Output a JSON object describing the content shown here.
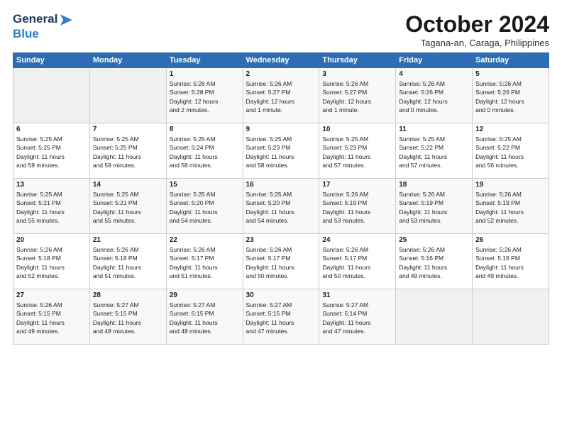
{
  "logo": {
    "line1": "General",
    "line2": "Blue"
  },
  "title": "October 2024",
  "location": "Tagana-an, Caraga, Philippines",
  "header_days": [
    "Sunday",
    "Monday",
    "Tuesday",
    "Wednesday",
    "Thursday",
    "Friday",
    "Saturday"
  ],
  "weeks": [
    [
      {
        "day": "",
        "info": ""
      },
      {
        "day": "",
        "info": ""
      },
      {
        "day": "1",
        "info": "Sunrise: 5:26 AM\nSunset: 5:28 PM\nDaylight: 12 hours\nand 2 minutes."
      },
      {
        "day": "2",
        "info": "Sunrise: 5:26 AM\nSunset: 5:27 PM\nDaylight: 12 hours\nand 1 minute."
      },
      {
        "day": "3",
        "info": "Sunrise: 5:26 AM\nSunset: 5:27 PM\nDaylight: 12 hours\nand 1 minute."
      },
      {
        "day": "4",
        "info": "Sunrise: 5:26 AM\nSunset: 5:26 PM\nDaylight: 12 hours\nand 0 minutes."
      },
      {
        "day": "5",
        "info": "Sunrise: 5:26 AM\nSunset: 5:26 PM\nDaylight: 12 hours\nand 0 minutes."
      }
    ],
    [
      {
        "day": "6",
        "info": "Sunrise: 5:25 AM\nSunset: 5:25 PM\nDaylight: 11 hours\nand 59 minutes."
      },
      {
        "day": "7",
        "info": "Sunrise: 5:25 AM\nSunset: 5:25 PM\nDaylight: 11 hours\nand 59 minutes."
      },
      {
        "day": "8",
        "info": "Sunrise: 5:25 AM\nSunset: 5:24 PM\nDaylight: 11 hours\nand 58 minutes."
      },
      {
        "day": "9",
        "info": "Sunrise: 5:25 AM\nSunset: 5:23 PM\nDaylight: 11 hours\nand 58 minutes."
      },
      {
        "day": "10",
        "info": "Sunrise: 5:25 AM\nSunset: 5:23 PM\nDaylight: 11 hours\nand 57 minutes."
      },
      {
        "day": "11",
        "info": "Sunrise: 5:25 AM\nSunset: 5:22 PM\nDaylight: 11 hours\nand 57 minutes."
      },
      {
        "day": "12",
        "info": "Sunrise: 5:25 AM\nSunset: 5:22 PM\nDaylight: 11 hours\nand 56 minutes."
      }
    ],
    [
      {
        "day": "13",
        "info": "Sunrise: 5:25 AM\nSunset: 5:21 PM\nDaylight: 11 hours\nand 55 minutes."
      },
      {
        "day": "14",
        "info": "Sunrise: 5:25 AM\nSunset: 5:21 PM\nDaylight: 11 hours\nand 55 minutes."
      },
      {
        "day": "15",
        "info": "Sunrise: 5:25 AM\nSunset: 5:20 PM\nDaylight: 11 hours\nand 54 minutes."
      },
      {
        "day": "16",
        "info": "Sunrise: 5:25 AM\nSunset: 5:20 PM\nDaylight: 11 hours\nand 54 minutes."
      },
      {
        "day": "17",
        "info": "Sunrise: 5:26 AM\nSunset: 5:19 PM\nDaylight: 11 hours\nand 53 minutes."
      },
      {
        "day": "18",
        "info": "Sunrise: 5:26 AM\nSunset: 5:19 PM\nDaylight: 11 hours\nand 53 minutes."
      },
      {
        "day": "19",
        "info": "Sunrise: 5:26 AM\nSunset: 5:19 PM\nDaylight: 11 hours\nand 52 minutes."
      }
    ],
    [
      {
        "day": "20",
        "info": "Sunrise: 5:26 AM\nSunset: 5:18 PM\nDaylight: 11 hours\nand 52 minutes."
      },
      {
        "day": "21",
        "info": "Sunrise: 5:26 AM\nSunset: 5:18 PM\nDaylight: 11 hours\nand 51 minutes."
      },
      {
        "day": "22",
        "info": "Sunrise: 5:26 AM\nSunset: 5:17 PM\nDaylight: 11 hours\nand 51 minutes."
      },
      {
        "day": "23",
        "info": "Sunrise: 5:26 AM\nSunset: 5:17 PM\nDaylight: 11 hours\nand 50 minutes."
      },
      {
        "day": "24",
        "info": "Sunrise: 5:26 AM\nSunset: 5:17 PM\nDaylight: 11 hours\nand 50 minutes."
      },
      {
        "day": "25",
        "info": "Sunrise: 5:26 AM\nSunset: 5:16 PM\nDaylight: 11 hours\nand 49 minutes."
      },
      {
        "day": "26",
        "info": "Sunrise: 5:26 AM\nSunset: 5:16 PM\nDaylight: 11 hours\nand 49 minutes."
      }
    ],
    [
      {
        "day": "27",
        "info": "Sunrise: 5:26 AM\nSunset: 5:15 PM\nDaylight: 11 hours\nand 49 minutes."
      },
      {
        "day": "28",
        "info": "Sunrise: 5:27 AM\nSunset: 5:15 PM\nDaylight: 11 hours\nand 48 minutes."
      },
      {
        "day": "29",
        "info": "Sunrise: 5:27 AM\nSunset: 5:15 PM\nDaylight: 11 hours\nand 48 minutes."
      },
      {
        "day": "30",
        "info": "Sunrise: 5:27 AM\nSunset: 5:15 PM\nDaylight: 11 hours\nand 47 minutes."
      },
      {
        "day": "31",
        "info": "Sunrise: 5:27 AM\nSunset: 5:14 PM\nDaylight: 11 hours\nand 47 minutes."
      },
      {
        "day": "",
        "info": ""
      },
      {
        "day": "",
        "info": ""
      }
    ]
  ]
}
